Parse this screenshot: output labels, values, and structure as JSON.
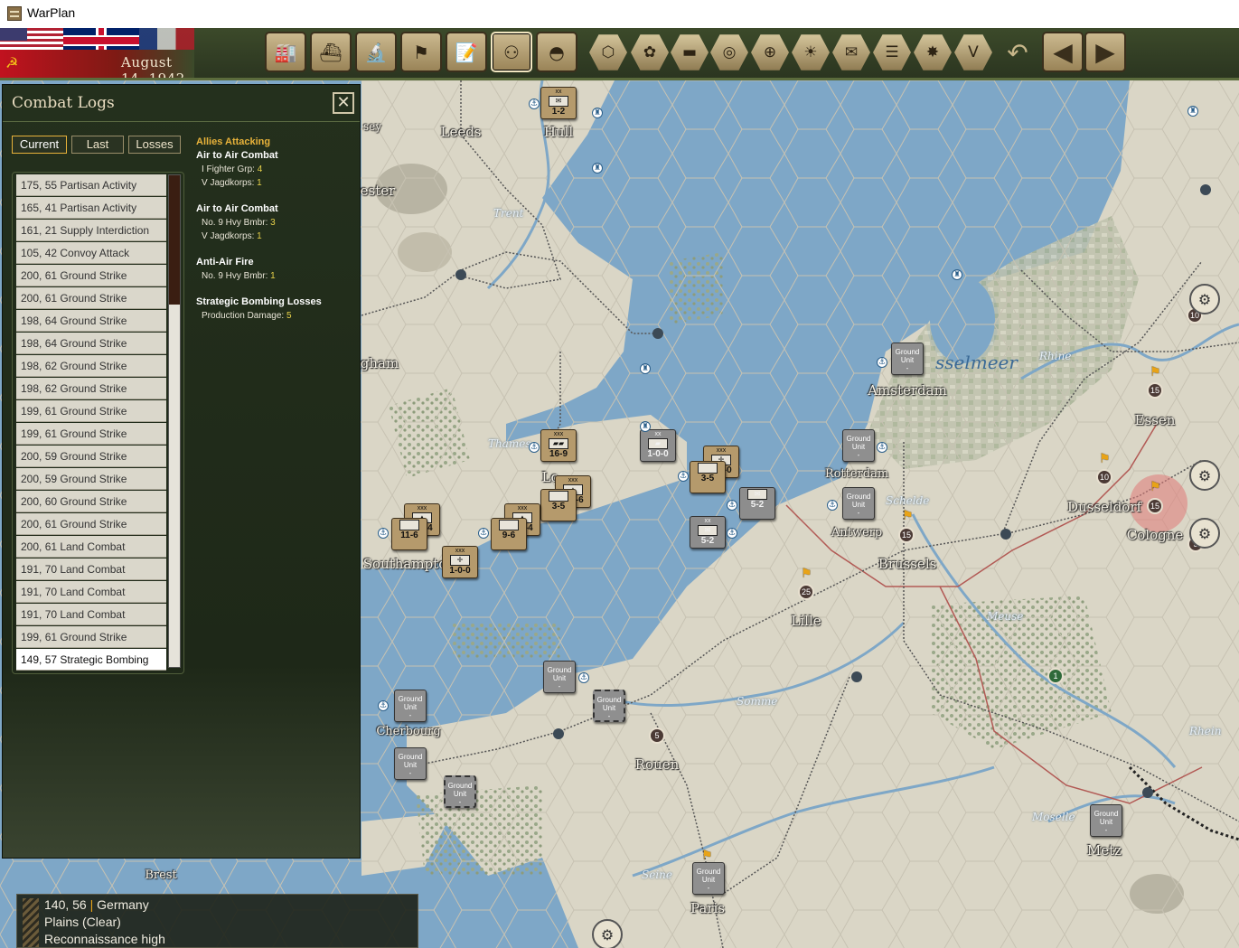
{
  "window": {
    "title": "WarPlan"
  },
  "topbar": {
    "date": "August 14, 1942",
    "buttons": [
      {
        "name": "production-button",
        "icon": "factory-icon"
      },
      {
        "name": "naval-button",
        "icon": "ship-icon"
      },
      {
        "name": "research-button",
        "icon": "microscope-icon"
      },
      {
        "name": "objectives-button",
        "icon": "flag-icon"
      },
      {
        "name": "reports-button",
        "icon": "report-icon"
      },
      {
        "name": "combat-logs-button",
        "icon": "binoculars-icon",
        "active": true
      },
      {
        "name": "units-button",
        "icon": "helmet-icon"
      }
    ],
    "filters": [
      {
        "name": "hex-grid-toggle",
        "icon": "hexagon-icon"
      },
      {
        "name": "supply-toggle",
        "icon": "hex-cluster-icon"
      },
      {
        "name": "unit-toggle",
        "icon": "tank-icon"
      },
      {
        "name": "resources-toggle",
        "icon": "coins-icon"
      },
      {
        "name": "targets-toggle",
        "icon": "crosshair-icon"
      },
      {
        "name": "weather-toggle",
        "icon": "sun-icon"
      },
      {
        "name": "mail-toggle",
        "icon": "envelope-icon"
      },
      {
        "name": "rail-toggle",
        "icon": "rail-icon"
      },
      {
        "name": "explosion-toggle",
        "icon": "explosion-icon"
      },
      {
        "name": "victory-toggle",
        "icon": "victory-v-icon",
        "text": "V"
      }
    ],
    "undo_icon": "undo-icon",
    "prev_icon": "arrow-left-icon",
    "next_icon": "arrow-right-icon"
  },
  "combat_logs": {
    "title": "Combat Logs",
    "close_icon": "close-icon",
    "tabs": [
      "Current",
      "Last",
      "Losses"
    ],
    "active_tab": "Current",
    "scroll_position": 0.0,
    "entries": [
      "175, 55 Partisan Activity",
      "165, 41 Partisan Activity",
      "161, 21 Supply Interdiction",
      "105, 42 Convoy Attack",
      "200, 61 Ground Strike",
      "200, 61 Ground Strike",
      "198, 64 Ground Strike",
      "198, 64 Ground Strike",
      "198, 62 Ground Strike",
      "198, 62 Ground Strike",
      "199, 61 Ground Strike",
      "199, 61 Ground Strike",
      "200, 59 Ground Strike",
      "200, 59 Ground Strike",
      "200, 60 Ground Strike",
      "200, 61 Ground Strike",
      "200, 61 Land Combat",
      "191, 70 Land Combat",
      "191, 70 Land Combat",
      "191, 70 Land Combat",
      "199, 61 Ground Strike",
      "149, 57 Strategic Bombing"
    ],
    "selected_entry": "149, 57 Strategic Bombing",
    "detail": {
      "header": "Allies Attacking",
      "sections": [
        {
          "title": "Air to Air Combat",
          "lines": [
            {
              "label": "I Fighter Grp:",
              "value": "4"
            },
            {
              "label": "V Jagdkorps:",
              "value": "1"
            }
          ]
        },
        {
          "title": "Air to Air Combat",
          "lines": [
            {
              "label": "No. 9 Hvy Bmbr:",
              "value": "3"
            },
            {
              "label": "V Jagdkorps:",
              "value": "1"
            }
          ]
        },
        {
          "title": "Anti-Air Fire",
          "lines": [
            {
              "label": "No. 9 Hvy Bmbr:",
              "value": "1"
            }
          ]
        },
        {
          "title": "Strategic Bombing Losses",
          "lines": [
            {
              "label": "Production Damage:",
              "value": "5"
            }
          ]
        }
      ]
    }
  },
  "map": {
    "cities": [
      "Leeds",
      "Hull",
      "Amsterdam",
      "Rotterdam",
      "Antwerp",
      "Brussels",
      "Essen",
      "Dusseldorf",
      "Cologne",
      "Lille",
      "Rouen",
      "Paris",
      "Cherbourg",
      "Metz",
      "Brest",
      "Southampto",
      "Lo",
      "ester",
      "gham",
      "sey"
    ],
    "rivers": [
      "Trent",
      "Thames",
      "Schelde",
      "Rhine",
      "Meuse",
      "Somme",
      "Rhein",
      "Moselle",
      "Seine"
    ],
    "sea_labels": [
      "sselmeer"
    ],
    "ground_unit_label": [
      "Ground",
      "Unit",
      "-"
    ],
    "counters": [
      {
        "size": "xx",
        "glyph": "✉",
        "value": "1-2"
      },
      {
        "size": "xxx",
        "glyph": "▰▰",
        "value": "16-9"
      },
      {
        "size": "xx",
        "glyph": "▰",
        "value": "1-0-0"
      },
      {
        "size": "xxx",
        "glyph": "✛",
        "value": "1-1-0"
      },
      {
        "size": "",
        "glyph": "",
        "value": "3-5"
      },
      {
        "size": "",
        "glyph": "✉",
        "value": "5-2"
      },
      {
        "size": "xxx",
        "glyph": "▲",
        "value": "3-1-6"
      },
      {
        "size": "",
        "glyph": "",
        "value": "3-5"
      },
      {
        "size": "xx",
        "glyph": "✉",
        "value": "5-2"
      },
      {
        "size": "xxx",
        "glyph": "▲",
        "value": "2-0-4"
      },
      {
        "size": "",
        "glyph": "",
        "value": "11-6"
      },
      {
        "size": "xxx",
        "glyph": "▲",
        "value": "2-1-4"
      },
      {
        "size": "",
        "glyph": "",
        "value": "9-6"
      },
      {
        "size": "xxx",
        "glyph": "✛",
        "value": "1-0-0"
      }
    ],
    "badges": [
      "10",
      "15",
      "10",
      "15",
      "15",
      "25",
      "5",
      "1",
      "5"
    ],
    "facility_icon": "factory-site-icon"
  },
  "info_box": {
    "coords": "140, 56",
    "country": "Germany",
    "terrain": "Plains (Clear)",
    "recon": "Reconnaissance high"
  },
  "colors": {
    "sea": "#7ea7c7",
    "land": "#d8d4c4",
    "panel": "#24301d",
    "accent": "#e8b23a"
  }
}
